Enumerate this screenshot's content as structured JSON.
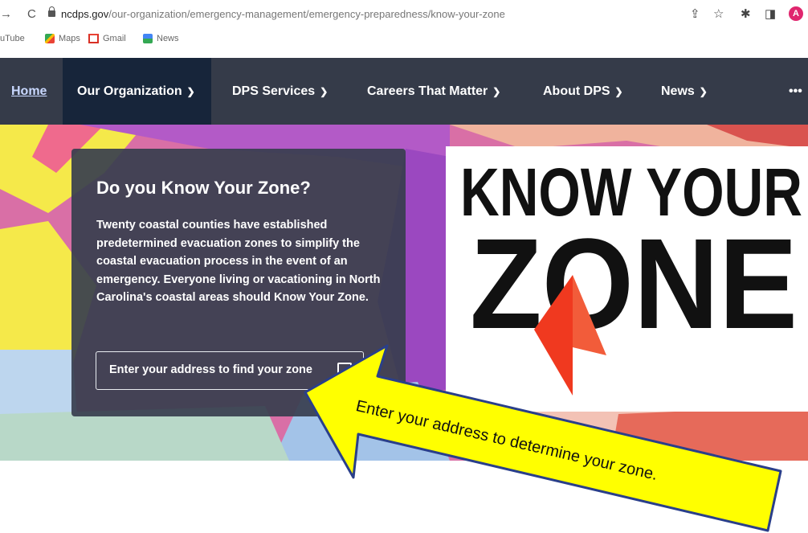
{
  "browser": {
    "url_host": "ncdps.gov",
    "url_path": "/our-organization/emergency-management/emergency-preparedness/know-your-zone",
    "profile_initial": "A",
    "icons": [
      "back-icon",
      "reload-icon",
      "lock-icon",
      "share-icon",
      "star-icon",
      "extensions-icon",
      "sidepanel-icon",
      "profile-icon"
    ]
  },
  "bookmarks": [
    {
      "label": "uTube",
      "icon": "youtube-icon"
    },
    {
      "label": "Maps",
      "icon": "maps-icon"
    },
    {
      "label": "Gmail",
      "icon": "gmail-icon"
    },
    {
      "label": "News",
      "icon": "news-icon"
    }
  ],
  "nav": {
    "home": "Home",
    "items": [
      {
        "label": "Our Organization"
      },
      {
        "label": "DPS Services"
      },
      {
        "label": "Careers That Matter"
      },
      {
        "label": "About DPS"
      },
      {
        "label": "News"
      }
    ],
    "more": "•••",
    "active_color": "#17253a",
    "bar_color": "#353b49"
  },
  "hero": {
    "title": "Do you Know Your Zone?",
    "body": "Twenty coastal counties have established predetermined evacuation zones to simplify the coastal evacuation process in the event of an emergency. Everyone living or vacationing in North Carolina's coastal areas should Know Your Zone.",
    "input_placeholder": "Enter your address to find your zone"
  },
  "logo": {
    "line1": "KNOW YOUR",
    "line2": "ZONE",
    "arrow_color": "#f0391f"
  },
  "callout": {
    "text": "Enter your address to determine your zone.",
    "fill_color": "#ffff00",
    "stroke_color": "#2a3f8a"
  }
}
